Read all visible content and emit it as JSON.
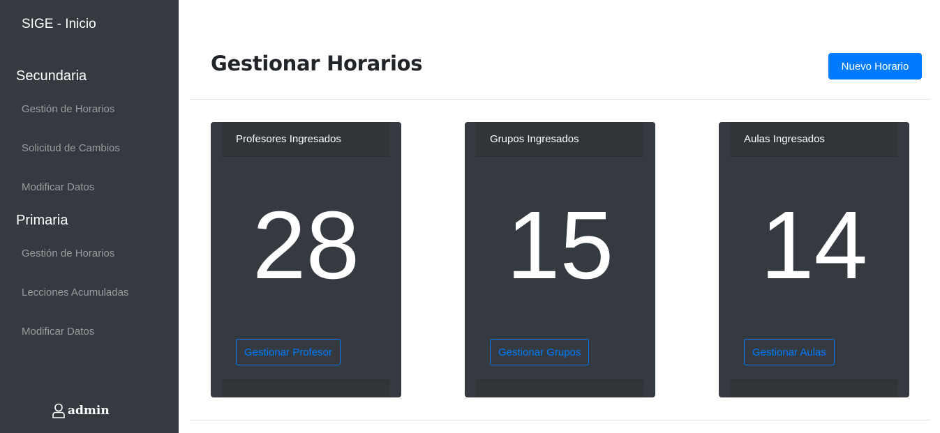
{
  "sidebar": {
    "brand": "SIGE - Inicio",
    "sections": [
      {
        "title": "Secundaria",
        "items": [
          "Gestión de Horarios",
          "Solicitud de Cambios",
          "Modificar Datos"
        ]
      },
      {
        "title": "Primaria",
        "items": [
          "Gestión de Horarios",
          "Lecciones Acumuladas",
          "Modificar Datos"
        ]
      }
    ],
    "user": {
      "icon": "user-icon",
      "name": "admin"
    }
  },
  "header": {
    "title": "Gestionar Horarios",
    "new_button": "Nuevo Horario"
  },
  "cards": [
    {
      "title": "Profesores Ingresados",
      "value": "28",
      "button": "Gestionar Profesor"
    },
    {
      "title": "Grupos Ingresados",
      "value": "15",
      "button": "Gestionar Grupos"
    },
    {
      "title": "Aulas Ingresados",
      "value": "14",
      "button": "Gestionar Aulas"
    }
  ],
  "colors": {
    "sidebar_bg": "#343a40",
    "primary": "#007bff",
    "card_bg": "#343a40",
    "muted_link": "#9a9da0"
  }
}
